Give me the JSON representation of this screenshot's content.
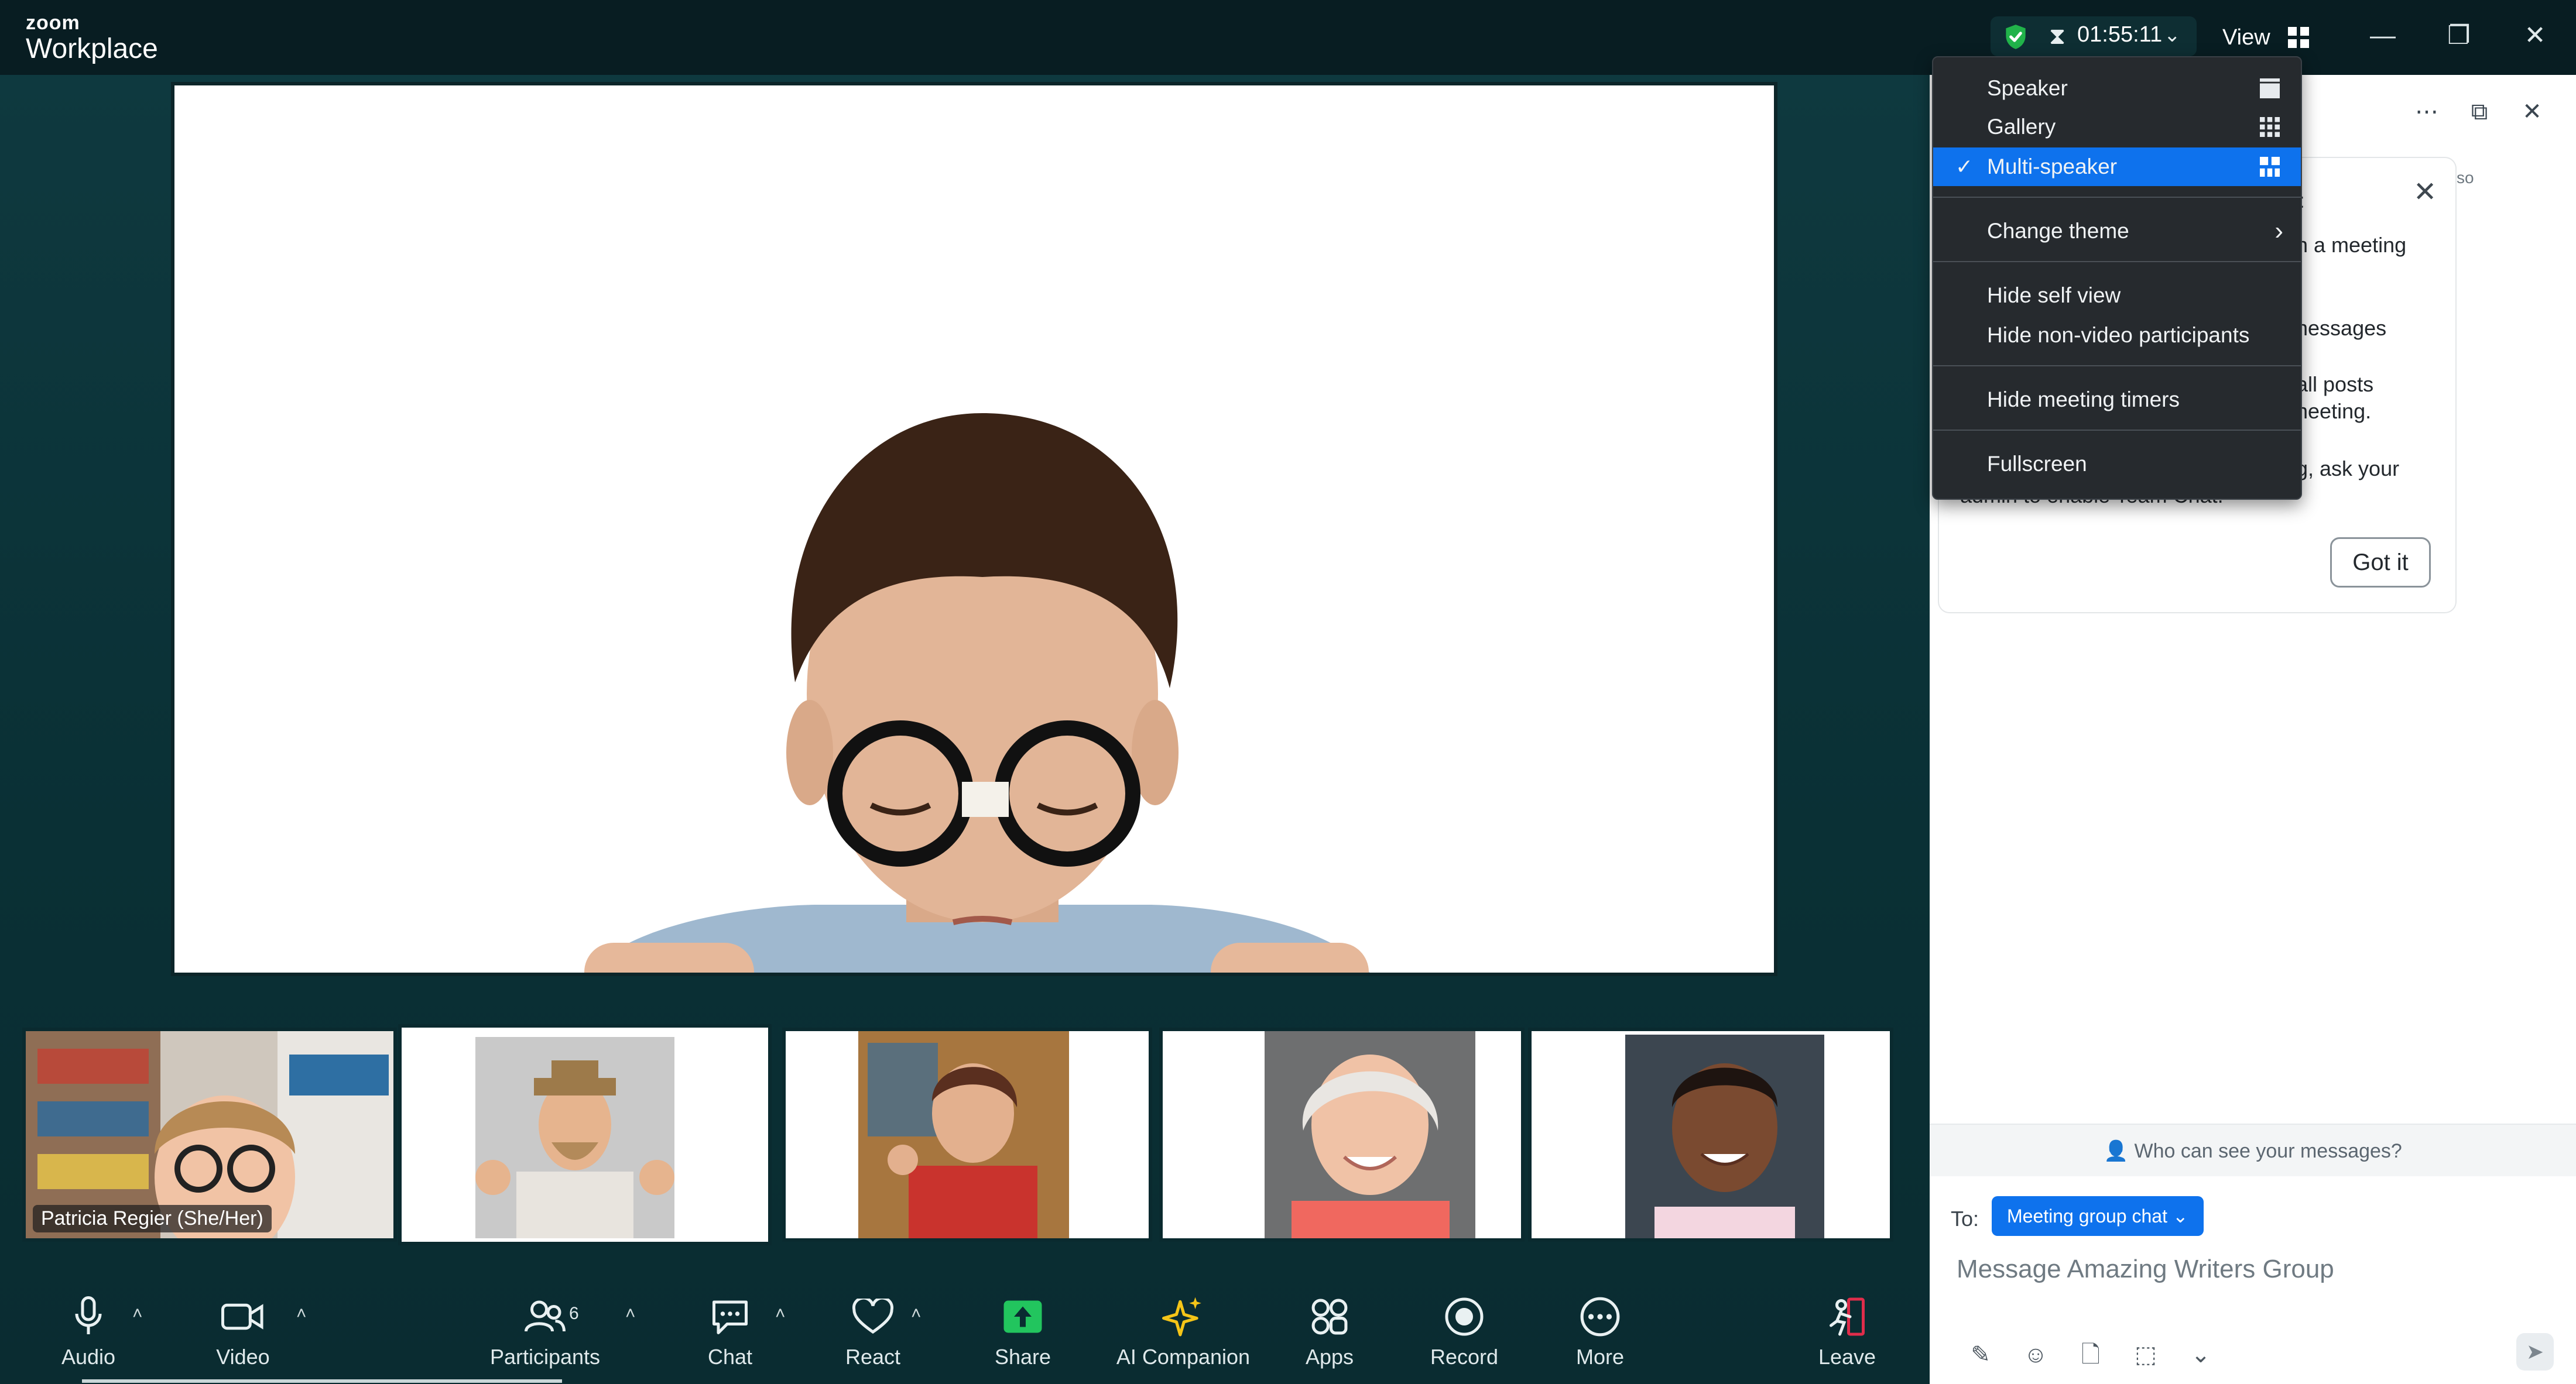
{
  "brand": {
    "line1": "zoom",
    "line2": "Workplace"
  },
  "header": {
    "timer": "01:55:11",
    "view_label": "View",
    "window_controls": [
      "minimize-icon",
      "restore-icon",
      "close-icon"
    ]
  },
  "view_menu": {
    "items": [
      {
        "label": "Speaker",
        "selected": false
      },
      {
        "label": "Gallery",
        "selected": false
      },
      {
        "label": "Multi-speaker",
        "selected": true
      },
      {
        "label": "Change theme",
        "submenu": true
      },
      {
        "label": "Hide self view"
      },
      {
        "label": "Hide non-video participants"
      },
      {
        "label": "Hide meeting timers"
      },
      {
        "label": "Fullscreen"
      }
    ]
  },
  "thumbnails": [
    {
      "name_tag": "Patricia Regier (She/Her)"
    }
  ],
  "toolbar": {
    "audio": "Audio",
    "video": "Video",
    "participants": "Participants",
    "participants_count": "6",
    "chat": "Chat",
    "react": "React",
    "share": "Share",
    "ai_companion": "AI Companion",
    "apps": "Apps",
    "record": "Record",
    "more": "More",
    "leave": "Leave"
  },
  "chat_panel": {
    "tip_fragments": [
      "t",
      "n a meeting",
      "t",
      "nessages",
      "all posts",
      "neeting.",
      "g, ask your",
      "admin to enable Team Chat."
    ],
    "tip_corner": "so",
    "got_it": "Got it",
    "who_can_see": "Who can see your messages?",
    "to_label": "To:",
    "recipient": "Meeting group chat",
    "placeholder": "Message Amazing Writers Group"
  },
  "colors": {
    "accent": "#0e72ed",
    "share_green": "#22c55e",
    "ai_yellow": "#f5c518",
    "leave_red": "#e02d4b",
    "shield_green": "#21b34a"
  }
}
